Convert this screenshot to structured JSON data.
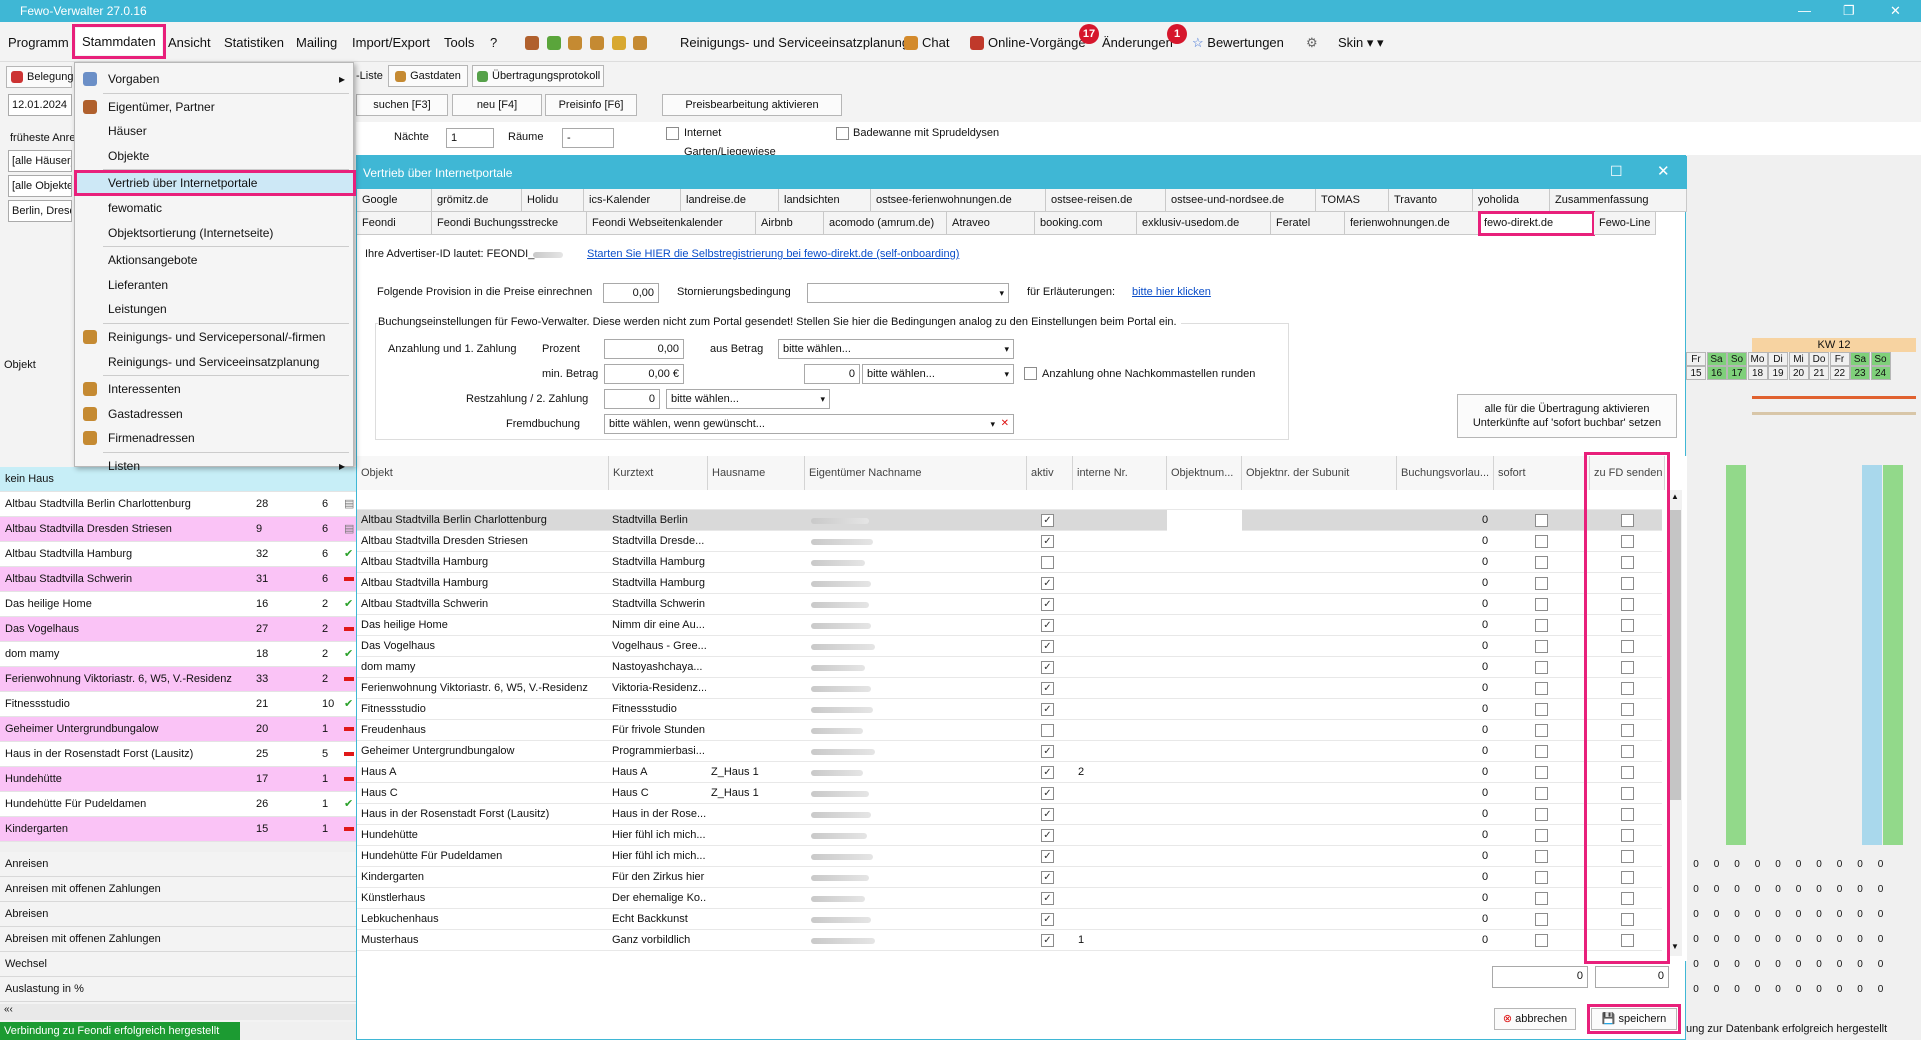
{
  "app": {
    "title": "Fewo-Verwalter 27.0.16",
    "win_min": "—",
    "win_max": "❐",
    "win_close": "✕"
  },
  "menu": {
    "programm": "Programm",
    "stammdaten": "Stammdaten",
    "ansicht": "Ansicht",
    "statistiken": "Statistiken",
    "mailing": "Mailing",
    "import_export": "Import/Export",
    "tools": "Tools",
    "help": "?",
    "reinigung": "Reinigungs- und Serviceeinsatzplanung",
    "chat": "Chat",
    "online_vorgaenge": "Online-Vorgänge",
    "online_badge": "17",
    "aenderungen": "Änderungen",
    "aenderungen_badge": "1",
    "bewertungen": "Bewertungen",
    "skin": "Skin"
  },
  "toolbar": {
    "belegung": "Belegung",
    "liste": "-Liste",
    "gastdaten": "Gastdaten",
    "protokoll": "Übertragungsprotokoll",
    "date": "12.01.2024",
    "suchen": "suchen [F3]",
    "neu": "neu [F4]",
    "preisinfo": "Preisinfo [F6]",
    "preis_aktivieren": "Preisbearbeitung aktivieren",
    "naechte_label": "Nächte",
    "naechte": "1",
    "raeume_label": "Räume",
    "raeume": "-",
    "internet": "Internet",
    "badewanne": "Badewanne mit Sprudeldysen",
    "garten": "Garten/Liegewiese"
  },
  "left": {
    "frueheste": "früheste Anre",
    "haeuser": "[alle Häuser]",
    "objekte": "[alle Objekte",
    "berlin": "Berlin, Dresd",
    "objekt_label": "Objekt",
    "kein_haus": "kein Haus",
    "rows": [
      {
        "name": "Altbau Stadtvilla Berlin Charlottenburg",
        "a": "28",
        "b": "6",
        "pink": false,
        "mark": "img"
      },
      {
        "name": "Altbau Stadtvilla Dresden Striesen",
        "a": "9",
        "b": "6",
        "pink": true,
        "mark": "img"
      },
      {
        "name": "Altbau Stadtvilla Hamburg",
        "a": "32",
        "b": "6",
        "pink": false,
        "mark": "check"
      },
      {
        "name": "Altbau Stadtvilla Schwerin",
        "a": "31",
        "b": "6",
        "pink": true,
        "mark": "dash"
      },
      {
        "name": "Das heilige Home",
        "a": "16",
        "b": "2",
        "pink": false,
        "mark": "check"
      },
      {
        "name": "Das Vogelhaus",
        "a": "27",
        "b": "2",
        "pink": true,
        "mark": "dash"
      },
      {
        "name": "dom mamy",
        "a": "18",
        "b": "2",
        "pink": false,
        "mark": "check"
      },
      {
        "name": "Ferienwohnung Viktoriastr. 6, W5, V.-Residenz",
        "a": "33",
        "b": "2",
        "pink": true,
        "mark": "dash"
      },
      {
        "name": "Fitnessstudio",
        "a": "21",
        "b": "10",
        "pink": false,
        "mark": "check"
      },
      {
        "name": "Geheimer Untergrundbungalow",
        "a": "20",
        "b": "1",
        "pink": true,
        "mark": "dash"
      },
      {
        "name": "Haus in der Rosenstadt Forst (Lausitz)",
        "a": "25",
        "b": "5",
        "pink": false,
        "mark": "dash"
      },
      {
        "name": "Hundehütte",
        "a": "17",
        "b": "1",
        "pink": true,
        "mark": "dash"
      },
      {
        "name": "Hundehütte Für Pudeldamen",
        "a": "26",
        "b": "1",
        "pink": false,
        "mark": "check"
      },
      {
        "name": "Kindergarten",
        "a": "15",
        "b": "1",
        "pink": true,
        "mark": "dash"
      }
    ],
    "bottom": [
      "Anreisen",
      "Anreisen mit offenen Zahlungen",
      "Abreisen",
      "Abreisen mit offenen Zahlungen",
      "Wechsel",
      "Auslastung in %"
    ],
    "status": "Verbindung zu Feondi erfolgreich hergestellt"
  },
  "dropdown": [
    {
      "label": "Vorgaben",
      "icon": "settings-doc-icon",
      "arrow": true
    },
    {
      "label": "Eigentümer, Partner",
      "icon": "owner-icon"
    },
    {
      "label": "Häuser"
    },
    {
      "label": "Objekte"
    },
    {
      "label": "Vertrieb über Internetportale",
      "selected": true
    },
    {
      "label": "fewomatic"
    },
    {
      "label": "Objektsortierung (Internetseite)"
    },
    {
      "label": "Aktionsangebote"
    },
    {
      "label": "Lieferanten"
    },
    {
      "label": "Leistungen"
    },
    {
      "label": "Reinigungs- und Servicepersonal/-firmen",
      "icon": "person-icon"
    },
    {
      "label": "Reinigungs- und Serviceeinsatzplanung"
    },
    {
      "label": "Interessenten",
      "icon": "person-icon"
    },
    {
      "label": "Gastadressen",
      "icon": "person-icon"
    },
    {
      "label": "Firmenadressen",
      "icon": "person-icon"
    },
    {
      "label": "Listen",
      "arrow": true
    }
  ],
  "dialog": {
    "title": "Vertrieb über Internetportale",
    "tabs_row1": [
      "Google",
      "grömitz.de",
      "Holidu",
      "ics-Kalender",
      "landreise.de",
      "landsichten",
      "ostsee-ferienwohnungen.de",
      "ostsee-reisen.de",
      "ostsee-und-nordsee.de",
      "TOMAS",
      "Travanto",
      "yoholida",
      "Zusammenfassung"
    ],
    "tabs_row2": [
      "Feondi",
      "Feondi Buchungsstrecke",
      "Feondi Webseitenkalender",
      "Airbnb",
      "acomodo (amrum.de)",
      "Atraveo",
      "booking.com",
      "exklusiv-usedom.de",
      "Feratel",
      "ferienwohnungen.de",
      "fewo-direkt.de",
      "Fewo-Line"
    ],
    "advertiser": "Ihre Advertiser-ID lautet: FEONDI_",
    "selfreg": "Starten Sie HIER die Selbstregistrierung bei fewo-direkt.de (self-onboarding)",
    "provision_label": "Folgende Provision in die Preise einrechnen",
    "provision": "0,00",
    "storno_label": "Stornierungsbedingung",
    "erl_label": "für Erläuterungen:",
    "erl_link": "bitte hier klicken",
    "buchung_note": "Buchungseinstellungen für Fewo-Verwalter. Diese werden nicht zum Portal gesendet! Stellen Sie hier die Bedingungen analog zu den Einstellungen beim Portal ein.",
    "anzahlung_label": "Anzahlung und 1. Zahlung",
    "prozent_label": "Prozent",
    "prozent": "0,00",
    "ausbetrag_label": "aus Betrag",
    "bitte_waehlen": "bitte wählen...",
    "minbetrag_label": "min. Betrag",
    "minbetrag": "0,00 €",
    "min_num": "0",
    "rund_label": "Anzahlung ohne Nachkommastellen runden",
    "rest_label": "Restzahlung / 2. Zahlung",
    "rest": "0",
    "fremd_label": "Fremdbuchung",
    "fremd": "bitte wählen, wenn gewünscht...",
    "alle_btn": "alle für die Übertragung aktivieren Unterkünfte auf 'sofort buchbar' setzen",
    "cols": [
      "Objekt",
      "Kurztext",
      "Hausname",
      "Eigentümer Nachname",
      "aktiv",
      "interne Nr.",
      "Objektnum...",
      "Objektnr. der Subunit",
      "Buchungsvorlau...",
      "sofort",
      "zu FD senden"
    ],
    "rows": [
      {
        "obj": "Altbau Stadtvilla Berlin Charlottenburg",
        "kurz": "Stadtvilla Berlin",
        "haus": "",
        "aktiv": true,
        "nr": "",
        "v": "0"
      },
      {
        "obj": "Altbau Stadtvilla Dresden Striesen",
        "kurz": "Stadtvilla Dresde...",
        "haus": "",
        "aktiv": true,
        "nr": "",
        "v": "0"
      },
      {
        "obj": "Altbau Stadtvilla Hamburg",
        "kurz": "Stadtvilla Hamburg",
        "haus": "",
        "aktiv": false,
        "nr": "",
        "v": "0"
      },
      {
        "obj": "Altbau Stadtvilla Hamburg",
        "kurz": "Stadtvilla Hamburg",
        "haus": "",
        "aktiv": true,
        "nr": "",
        "v": "0"
      },
      {
        "obj": "Altbau Stadtvilla Schwerin",
        "kurz": "Stadtvilla Schwerin",
        "haus": "",
        "aktiv": true,
        "nr": "",
        "v": "0"
      },
      {
        "obj": "Das heilige Home",
        "kurz": "Nimm dir eine Au...",
        "haus": "",
        "aktiv": true,
        "nr": "",
        "v": "0"
      },
      {
        "obj": "Das Vogelhaus",
        "kurz": "Vogelhaus - Gree...",
        "haus": "",
        "aktiv": true,
        "nr": "",
        "v": "0"
      },
      {
        "obj": "dom mamy",
        "kurz": "Nastoyashchaya...",
        "haus": "",
        "aktiv": true,
        "nr": "",
        "v": "0"
      },
      {
        "obj": "Ferienwohnung Viktoriastr. 6, W5, V.-Residenz",
        "kurz": "Viktoria-Residenz...",
        "haus": "",
        "aktiv": true,
        "nr": "",
        "v": "0"
      },
      {
        "obj": "Fitnessstudio",
        "kurz": "Fitnessstudio",
        "haus": "",
        "aktiv": true,
        "nr": "",
        "v": "0"
      },
      {
        "obj": "Freudenhaus",
        "kurz": "Für frivole Stunden",
        "haus": "",
        "aktiv": false,
        "nr": "",
        "v": "0"
      },
      {
        "obj": "Geheimer Untergrundbungalow",
        "kurz": "Programmierbasi...",
        "haus": "",
        "aktiv": true,
        "nr": "",
        "v": "0"
      },
      {
        "obj": "Haus A",
        "kurz": "Haus A",
        "haus": "Z_Haus 1",
        "aktiv": true,
        "nr": "2",
        "v": "0"
      },
      {
        "obj": "Haus C",
        "kurz": "Haus C",
        "haus": "Z_Haus 1",
        "aktiv": true,
        "nr": "",
        "v": "0"
      },
      {
        "obj": "Haus in der Rosenstadt Forst (Lausitz)",
        "kurz": "Haus in der Rose...",
        "haus": "",
        "aktiv": true,
        "nr": "",
        "v": "0"
      },
      {
        "obj": "Hundehütte",
        "kurz": "Hier fühl ich mich...",
        "haus": "",
        "aktiv": true,
        "nr": "",
        "v": "0"
      },
      {
        "obj": "Hundehütte Für Pudeldamen",
        "kurz": "Hier fühl ich mich...",
        "haus": "",
        "aktiv": true,
        "nr": "",
        "v": "0"
      },
      {
        "obj": "Kindergarten",
        "kurz": "Für den Zirkus hier",
        "haus": "",
        "aktiv": true,
        "nr": "",
        "v": "0"
      },
      {
        "obj": "Künstlerhaus",
        "kurz": "Der ehemalige Ko...",
        "haus": "",
        "aktiv": true,
        "nr": "",
        "v": "0"
      },
      {
        "obj": "Lebkuchenhaus",
        "kurz": "Echt Backkunst",
        "haus": "",
        "aktiv": true,
        "nr": "",
        "v": "0"
      },
      {
        "obj": "Musterhaus",
        "kurz": "Ganz vorbildlich",
        "haus": "",
        "aktiv": true,
        "nr": "1",
        "v": "0"
      }
    ],
    "sum1": "0",
    "sum2": "0",
    "abbrechen": "abbrechen",
    "speichern": "speichern"
  },
  "calendar": {
    "kw": "KW 12",
    "days": [
      "Fr",
      "Sa",
      "So",
      "Mo",
      "Di",
      "Mi",
      "Do",
      "Fr",
      "Sa",
      "So"
    ],
    "nums": [
      "15",
      "16",
      "17",
      "18",
      "19",
      "20",
      "21",
      "22",
      "23",
      "24"
    ],
    "zeros": "0",
    "footer": "ung zur Datenbank erfolgreich hergestellt"
  },
  "colors": {
    "accent": "#3fb7d5",
    "highlight": "#e8207b",
    "pink_row": "#fac3f6",
    "status_green": "#1c9b32"
  }
}
